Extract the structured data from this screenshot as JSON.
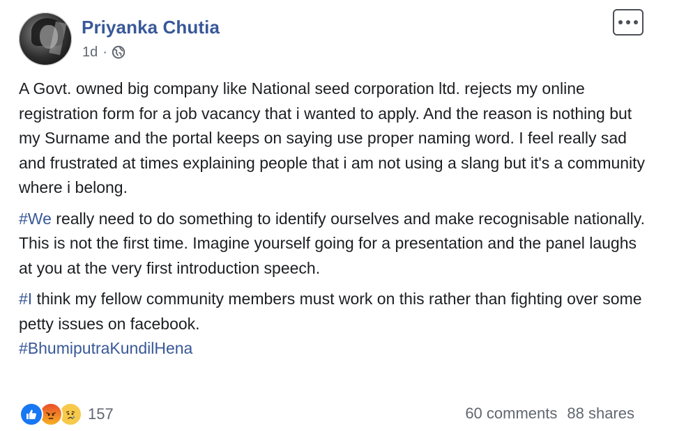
{
  "post": {
    "author": "Priyanka Chutia",
    "timestamp": "1d",
    "separator": "·",
    "privacy_icon": "globe-icon",
    "paragraphs": [
      {
        "text": "A Govt. owned big company like National seed corporation ltd. rejects my online registration form for a job vacancy that i wanted to apply. And the reason is nothing but my Surname and the portal keeps on saying use proper naming word. I feel really sad and frustrated at times explaining people that i am not using a slang but it's a community where i belong."
      },
      {
        "hashtag": "#We",
        "text": " really need to do something to identify ourselves and make recognisable nationally. This is not the first time. Imagine yourself going for a presentation and the panel laughs at you at the very first introduction speech."
      },
      {
        "hashtag": "#I",
        "text": " think my fellow community members must work on this rather than fighting over some petty issues on facebook.",
        "trailing_hashtag": "#BhumiputraKundilHena"
      }
    ]
  },
  "footer": {
    "reaction_icons": [
      "like-icon",
      "angry-icon",
      "sad-icon"
    ],
    "reaction_count": "157",
    "comments": "60 comments",
    "shares": "88 shares"
  },
  "colors": {
    "link": "#385898",
    "text": "#1c1e21",
    "secondary": "#606770"
  }
}
